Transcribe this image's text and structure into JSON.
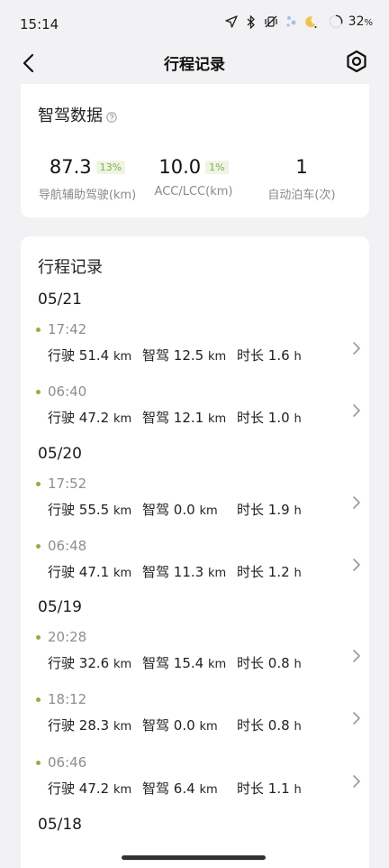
{
  "status_bar": {
    "time": "15:14",
    "battery_value": "32",
    "battery_unit": "%",
    "icons": [
      "location-arrow-icon",
      "bluetooth-icon",
      "vibrate-off-icon",
      "weather-icon",
      "moon-icon",
      "battery-ring-icon"
    ]
  },
  "nav": {
    "title": "行程记录",
    "back_icon": "chevron-left-icon",
    "settings_icon": "hexagon-settings-icon"
  },
  "summary": {
    "title": "智驾数据",
    "help_icon": "question-circle-icon",
    "stats": [
      {
        "value": "87.3",
        "pct": "13%",
        "label": "导航辅助驾驶(km)"
      },
      {
        "value": "10.0",
        "pct": "1%",
        "label": "ACC/LCC(km)"
      },
      {
        "value": "1",
        "pct": "",
        "label": "自动泊车(次)"
      }
    ]
  },
  "trips": {
    "title": "行程记录",
    "labels": {
      "drive": "行驶",
      "smart": "智驾",
      "duration": "时长",
      "km": "km",
      "h": "h"
    },
    "days": [
      {
        "date": "05/21",
        "items": [
          {
            "time": "17:42",
            "drive": "51.4",
            "smart": "12.5",
            "duration": "1.6"
          },
          {
            "time": "06:40",
            "drive": "47.2",
            "smart": "12.1",
            "duration": "1.0"
          }
        ]
      },
      {
        "date": "05/20",
        "items": [
          {
            "time": "17:52",
            "drive": "55.5",
            "smart": "0.0",
            "duration": "1.9"
          },
          {
            "time": "06:48",
            "drive": "47.1",
            "smart": "11.3",
            "duration": "1.2"
          }
        ]
      },
      {
        "date": "05/19",
        "items": [
          {
            "time": "20:28",
            "drive": "32.6",
            "smart": "15.4",
            "duration": "0.8"
          },
          {
            "time": "18:12",
            "drive": "28.3",
            "smart": "0.0",
            "duration": "0.8"
          },
          {
            "time": "06:46",
            "drive": "47.2",
            "smart": "6.4",
            "duration": "1.1"
          }
        ]
      },
      {
        "date": "05/18",
        "items": []
      }
    ]
  },
  "colors": {
    "accent_green": "#8bb04a",
    "background": "#f2f2f4",
    "card": "#ffffff"
  }
}
